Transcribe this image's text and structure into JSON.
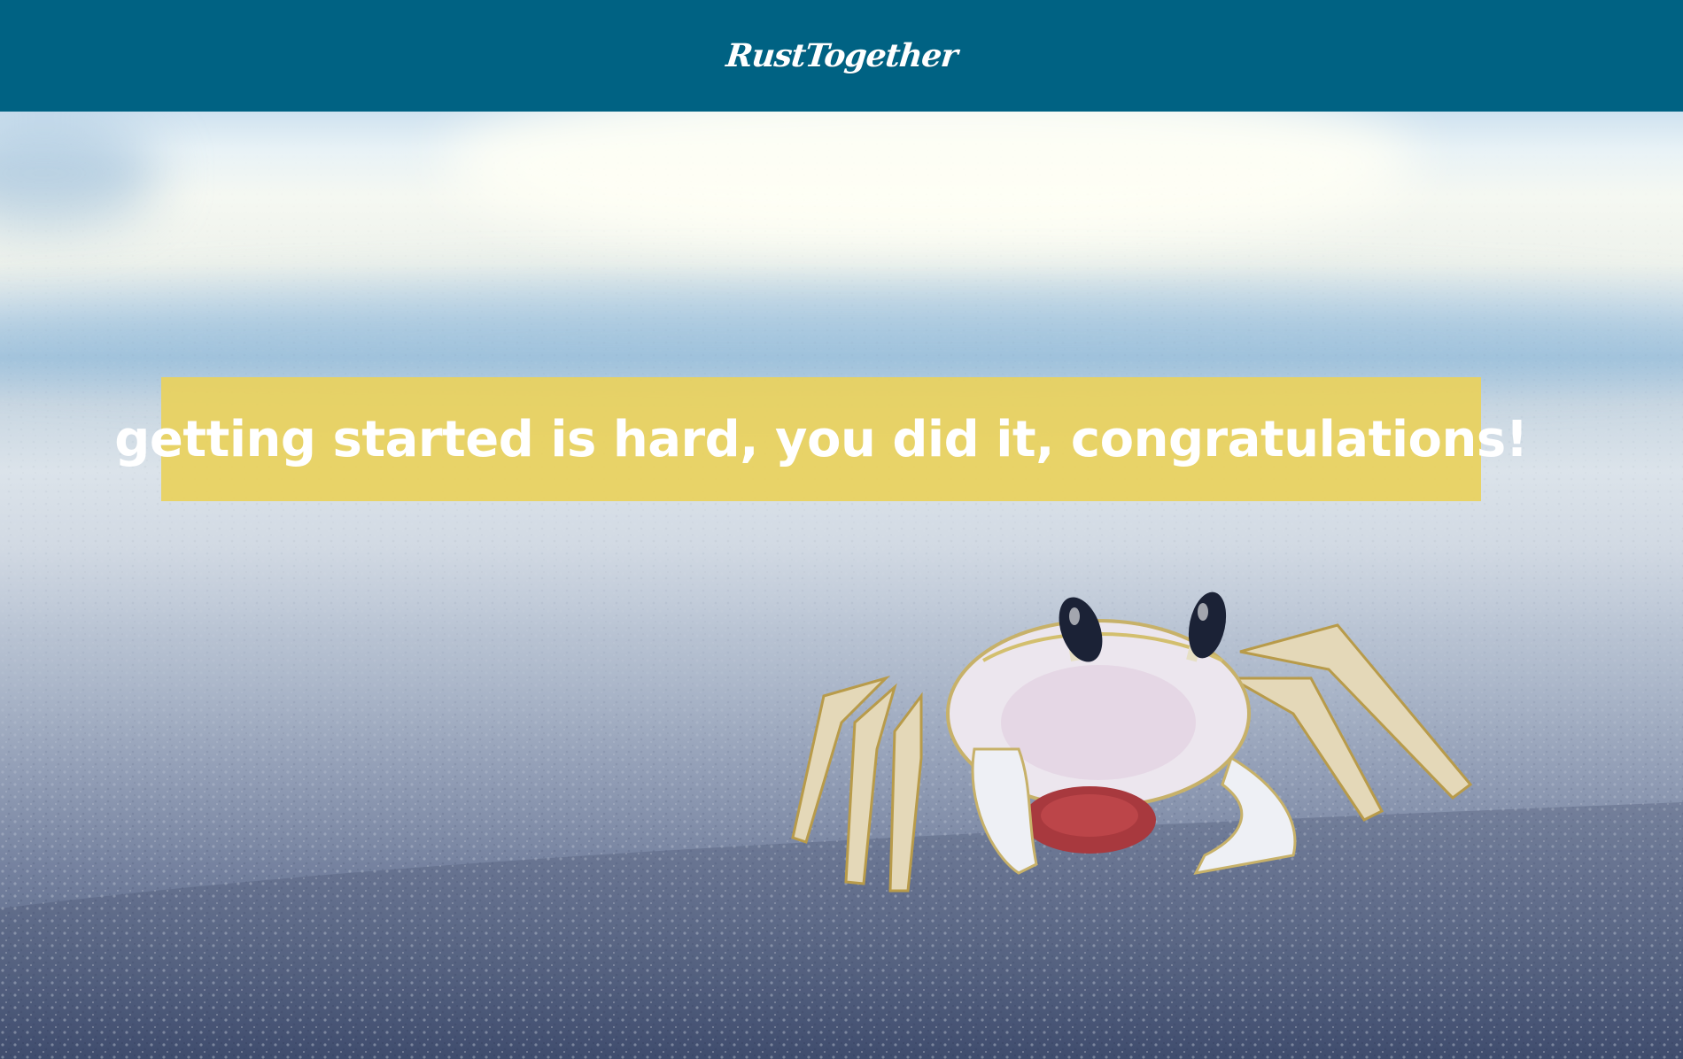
{
  "header": {
    "logo_text": "RustTogether",
    "background_color": "#006283"
  },
  "hero": {
    "image_subject": "crab-on-sand-photo",
    "banner": {
      "text": "getting started is hard, you did it, congratulations!",
      "background_color": "#e9d15c"
    }
  }
}
